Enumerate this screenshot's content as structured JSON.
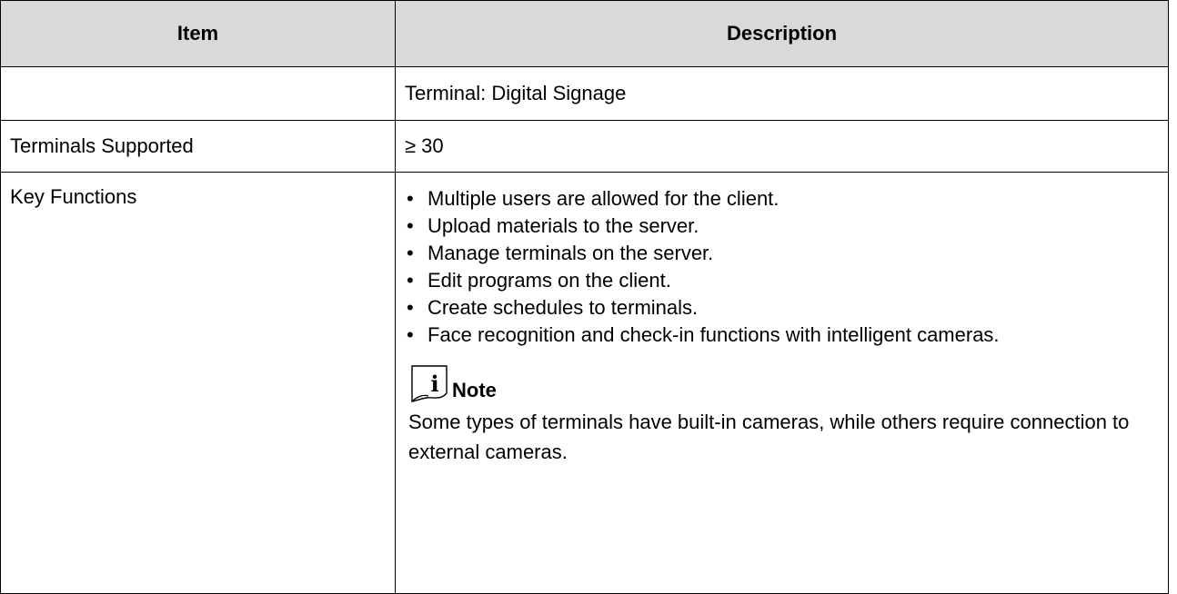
{
  "table": {
    "headers": {
      "item": "Item",
      "description": "Description"
    },
    "rows": [
      {
        "item": "",
        "description": "Terminal: Digital Signage"
      },
      {
        "item": "Terminals Supported",
        "description": "≥ 30"
      },
      {
        "item": "Key Functions",
        "bullets": [
          "Multiple users are allowed for the client.",
          "Upload materials to the server.",
          "Manage terminals on the server.",
          "Edit programs on the client.",
          "Create schedules to terminals.",
          "Face recognition and check-in functions with intelligent cameras."
        ],
        "note": {
          "icon": "info-note-icon",
          "label": "Note",
          "text": "Some types of terminals have built-in cameras, while others require connection to external cameras."
        }
      }
    ]
  },
  "colors": {
    "header_background": "#d9d9d9",
    "border": "#000000",
    "text": "#000000"
  }
}
